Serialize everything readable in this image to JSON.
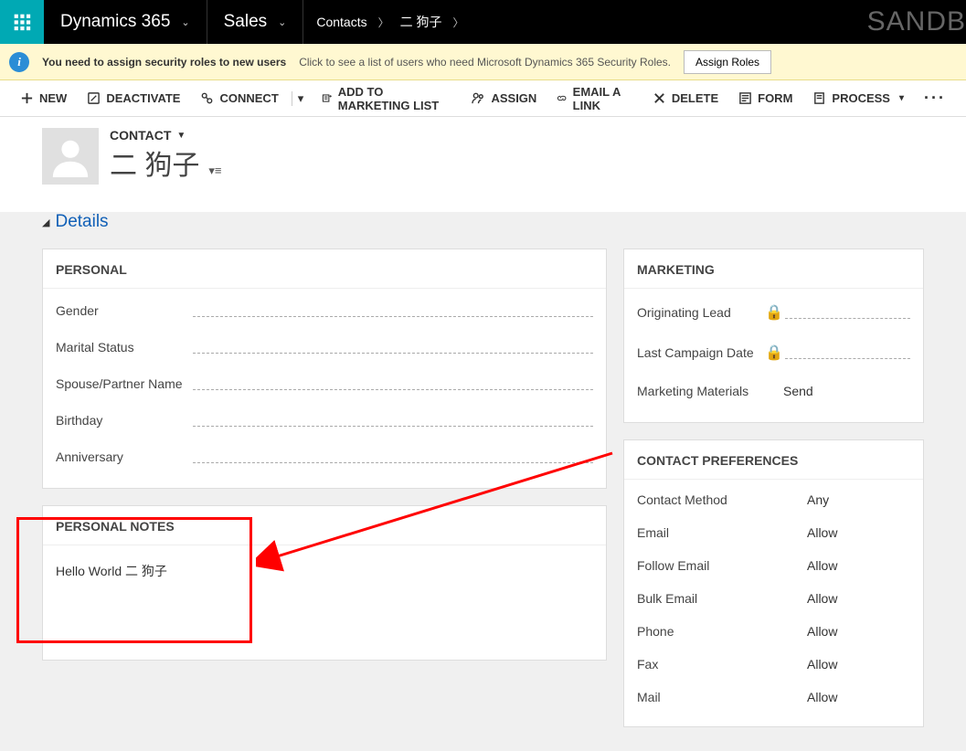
{
  "topbar": {
    "product": "Dynamics 365",
    "module": "Sales",
    "breadcrumb1": "Contacts",
    "breadcrumb2": "二 狗子",
    "watermark": "SANDB"
  },
  "notify": {
    "bold": "You need to assign security roles to new users",
    "sub": "Click to see a list of users who need Microsoft Dynamics 365 Security Roles.",
    "button": "Assign Roles"
  },
  "commands": {
    "new": "NEW",
    "deactivate": "DEACTIVATE",
    "connect": "CONNECT",
    "addmarketing": "ADD TO MARKETING LIST",
    "assign": "ASSIGN",
    "emaillink": "EMAIL A LINK",
    "delete": "DELETE",
    "form": "FORM",
    "process": "PROCESS"
  },
  "record": {
    "type": "CONTACT",
    "name": "二 狗子"
  },
  "section": {
    "details": "Details"
  },
  "personal": {
    "title": "PERSONAL",
    "gender": "Gender",
    "marital": "Marital Status",
    "spouse": "Spouse/Partner Name",
    "birthday": "Birthday",
    "anniversary": "Anniversary"
  },
  "notes": {
    "title": "PERSONAL NOTES",
    "text": "Hello World 二 狗子"
  },
  "marketing": {
    "title": "MARKETING",
    "orig": "Originating Lead",
    "last": "Last Campaign Date",
    "mat": "Marketing Materials",
    "mat_val": "Send"
  },
  "prefs": {
    "title": "CONTACT PREFERENCES",
    "contact": "Contact Method",
    "contact_v": "Any",
    "email": "Email",
    "email_v": "Allow",
    "femail": "Follow Email",
    "femail_v": "Allow",
    "bulk": "Bulk Email",
    "bulk_v": "Allow",
    "phone": "Phone",
    "phone_v": "Allow",
    "fax": "Fax",
    "fax_v": "Allow",
    "mail": "Mail",
    "mail_v": "Allow"
  }
}
